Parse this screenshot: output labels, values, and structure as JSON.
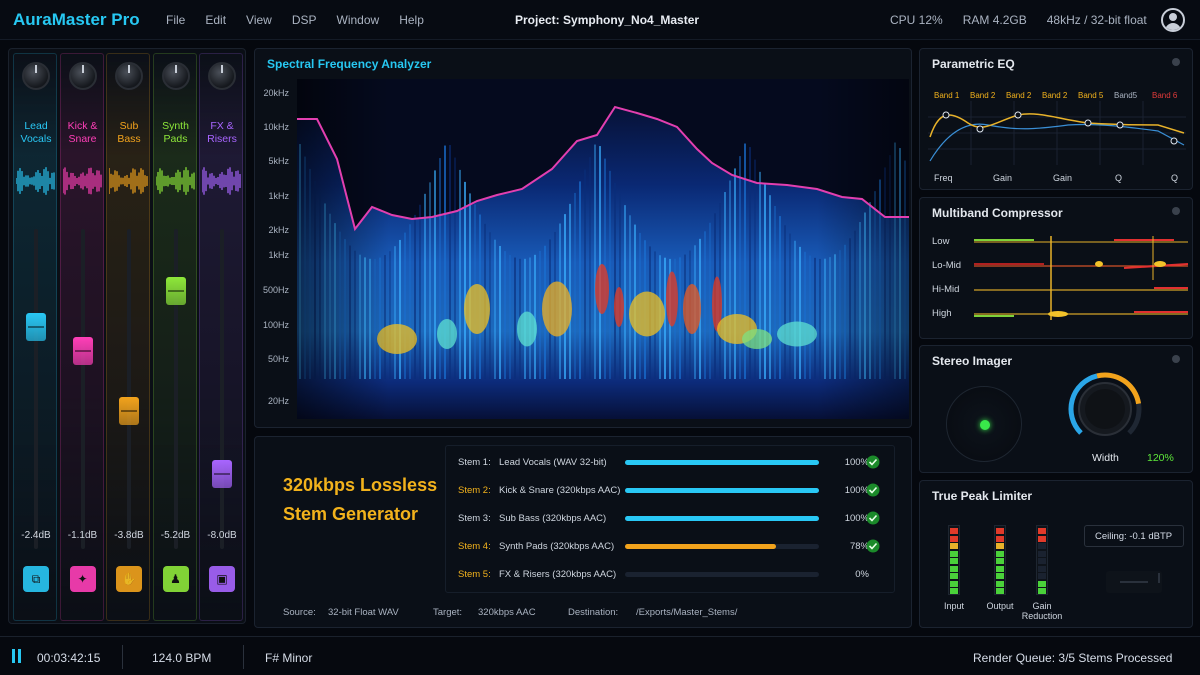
{
  "app": {
    "title": "AuraMaster Pro",
    "menu": [
      "File",
      "Edit",
      "View",
      "DSP",
      "Window",
      "Help"
    ],
    "project": "Project: Symphony_No4_Master",
    "cpu": "CPU  12%",
    "ram": "RAM  4.2GB",
    "format": "48kHz / 32-bit float"
  },
  "mixer": {
    "channels": [
      {
        "name": "Lead Vocals",
        "db": "-2.4dB",
        "color": "#29c8f5",
        "fader": 0.72,
        "icon": "link-icon"
      },
      {
        "name": "Kick & Snare",
        "db": "-1.1dB",
        "color": "#ff3fb8",
        "fader": 0.64,
        "icon": "sparkle-icon"
      },
      {
        "name": "Sub Bass",
        "db": "-3.8dB",
        "color": "#f2a31c",
        "fader": 0.44,
        "icon": "thumbs-icon"
      },
      {
        "name": "Synth Pads",
        "db": "-5.2dB",
        "color": "#8ee83a",
        "fader": 0.84,
        "icon": "figure-icon"
      },
      {
        "name": "FX & Risers",
        "db": "-8.0dB",
        "color": "#a865ff",
        "fader": 0.23,
        "icon": "box-icon"
      }
    ]
  },
  "analyzer": {
    "title": "Spectral Frequency Analyzer",
    "ticks": [
      "20kHz",
      "10kHz",
      "5kHz",
      "1kHz",
      "2kHz",
      "1kHz",
      "500Hz",
      "100Hz",
      "50Hz",
      "20Hz"
    ]
  },
  "stems": {
    "title_line1": "320kbps Lossless",
    "title_line2": "Stem Generator",
    "rows": [
      {
        "num": "Stem 1:",
        "name": "Lead Vocals  (WAV 32-bit)",
        "pct": "100%",
        "progress": 100,
        "color": "#29c8f5",
        "done": true
      },
      {
        "num": "Stem 2:",
        "name": "Kick & Snare  (320kbps AAC)",
        "pct": "100%",
        "progress": 100,
        "color": "#29c8f5",
        "done": true
      },
      {
        "num": "Stem 3:",
        "name": "Sub Bass  (320kbps AAC)",
        "pct": "100%",
        "progress": 100,
        "color": "#29c8f5",
        "done": true
      },
      {
        "num": "Stem 4:",
        "name": "Synth Pads  (320kbps AAC)",
        "pct": "78%",
        "progress": 78,
        "color": "#f2a31c",
        "done": true
      },
      {
        "num": "Stem 5:",
        "name": "FX & Risers  (320kbps AAC)",
        "pct": "0%",
        "progress": 0,
        "color": "#29c8f5",
        "done": false
      }
    ],
    "source_label": "Source:",
    "source": "32-bit Float WAV",
    "target_label": "Target:",
    "target": "320kbps AAC",
    "dest_label": "Destination:",
    "dest": "/Exports/Master_Stems/"
  },
  "eq": {
    "title": "Parametric EQ",
    "bands": [
      "Band 1",
      "Band 2",
      "Band 2",
      "Band 2",
      "Band 5",
      "Band5",
      "Band 6"
    ],
    "params": [
      "Freq",
      "Gain",
      "Gain",
      "Q",
      "Q"
    ]
  },
  "compressor": {
    "title": "Multiband Compressor",
    "bands": [
      "Low",
      "Lo-Mid",
      "Hi-Mid",
      "High"
    ]
  },
  "imager": {
    "title": "Stereo Imager",
    "width_label": "Width",
    "width_value": "120%",
    "width": 1.2
  },
  "limiter": {
    "title": "True Peak Limiter",
    "meters": [
      "Input",
      "Output",
      "Gain Reduction"
    ],
    "ceiling": "Ceiling:  -0.1 dBTP"
  },
  "status": {
    "time": "00:03:42:15",
    "bpm": "124.0 BPM",
    "key": "F# Minor",
    "queue": "Render Queue:  3/5 Stems Processed"
  }
}
